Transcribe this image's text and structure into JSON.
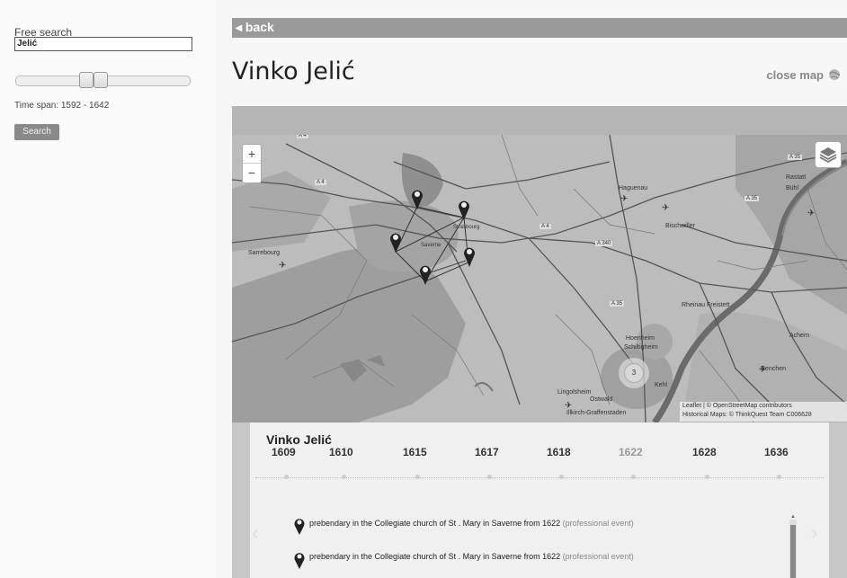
{
  "sidebar": {
    "search_label": "Free search",
    "search_value": "Jelić",
    "timespan_label": "Time span:",
    "timespan_value": "1592 - 1642",
    "search_button": "Search"
  },
  "header": {
    "back_label": "◂ back",
    "title": "Vinko Jelić",
    "close_map_label": "close map"
  },
  "map": {
    "zoom_in": "+",
    "zoom_out": "−",
    "attribution_line1": "Leaflet | © OpenStreetMap contributors",
    "attribution_line2": "Historical Maps: © ThinkQuest Team C006628",
    "cluster_count": "3",
    "labels": {
      "a4_1": "A 4",
      "a4_2": "A 4",
      "a4_3": "A 4",
      "a340": "A 340",
      "a35_1": "A 35",
      "a35_2": "A 35",
      "a35_3": "A 35",
      "haguenau": "Haguenau",
      "bischwiller": "Bischwiller",
      "saverne": "Saverne",
      "sarrebourg": "Sarrebourg",
      "strasbourg": "Strasbourg",
      "rheinau": "Rheinau Freistett",
      "achern": "Achern",
      "oberkirch": "Renchen",
      "hoenheim": "Hoenheim",
      "schiltigheim": "Schiltigheim",
      "kehl": "Kehl",
      "ostwald": "Ostwald",
      "lingolsheim": "Lingolsheim",
      "illkirch": "Illkirch-Graffenstaden",
      "rastatt": "Rastatt",
      "buhl": "Bühl"
    }
  },
  "timeline": {
    "name": "Vinko Jelić",
    "years": [
      "1609",
      "1610",
      "1615",
      "1617",
      "1618",
      "1622",
      "1628",
      "1636"
    ],
    "dim_year_index": 5,
    "events": [
      {
        "text": "prebendary in the Collegiate church of St . Mary in Saverne from 1622",
        "type": "(professional event)"
      },
      {
        "text": "prebendary in the Collegiate church of St . Mary in Saverne from 1622",
        "type": "(professional event)"
      }
    ]
  }
}
